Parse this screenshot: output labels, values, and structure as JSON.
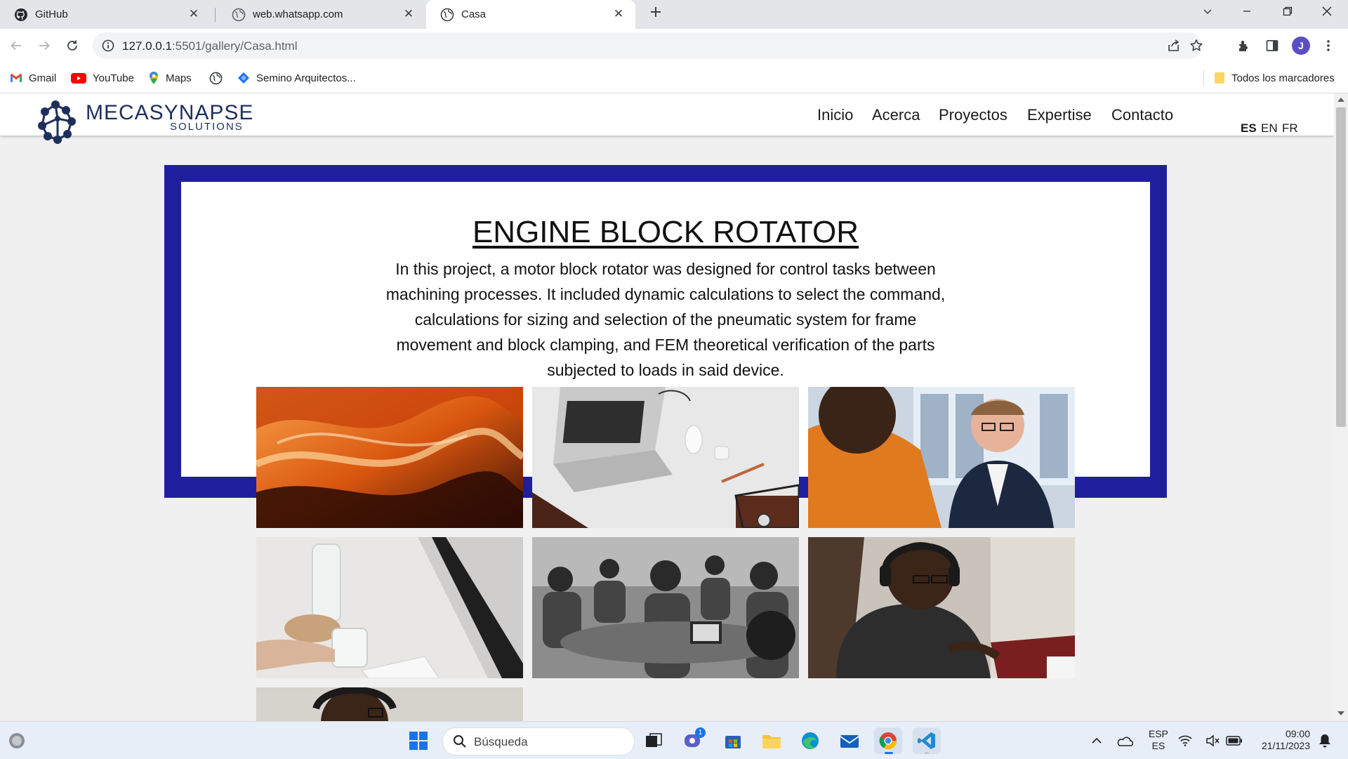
{
  "browser": {
    "tabs": [
      {
        "title": "GitHub",
        "icon": "github-icon"
      },
      {
        "title": "web.whatsapp.com",
        "icon": "globe-icon"
      },
      {
        "title": "Casa",
        "icon": "globe-icon",
        "active": true
      }
    ],
    "url": {
      "host": "127.0.0.1",
      "rest": ":5501/gallery/Casa.html"
    },
    "profile_initial": "J",
    "bookmarks": [
      {
        "label": "Gmail",
        "icon": "gmail-icon"
      },
      {
        "label": "YouTube",
        "icon": "youtube-icon"
      },
      {
        "label": "Maps",
        "icon": "maps-icon"
      },
      {
        "label": "",
        "icon": "globe-icon"
      },
      {
        "label": "Semino Arquitectos...",
        "icon": "diamond-icon"
      }
    ],
    "all_bookmarks": "Todos los marcadores"
  },
  "site": {
    "logo": {
      "name": "MECASYNAPSE",
      "sub": "SOLUTIONS"
    },
    "nav": [
      "Inicio",
      "Acerca",
      "Proyectos",
      "Expertise",
      "Contacto"
    ],
    "languages": [
      "ES",
      "EN",
      "FR"
    ],
    "active_language": "ES",
    "project": {
      "title": "ENGINE BLOCK ROTATOR",
      "description": "In this project, a motor block rotator was designed for control tasks between machining processes. It included dynamic calculations to select the command, calculations for sizing and selection of the pneumatic system for frame movement and block clamping, and FEM theoretical verification of the parts subjected to loads in said device."
    },
    "gallery": [
      {
        "subject": "canyon-photo"
      },
      {
        "subject": "laptop-desk-photo"
      },
      {
        "subject": "businessman-photo"
      },
      {
        "subject": "glass-on-desk-photo"
      },
      {
        "subject": "meeting-photo"
      },
      {
        "subject": "man-headphones-photo"
      },
      {
        "subject": "man-headphones-partial-photo"
      }
    ],
    "colors": {
      "frame": "#1f1f9e",
      "logo": "#1e2f5c"
    }
  },
  "taskbar": {
    "search_placeholder": "Búsqueda",
    "chat_badge": "1",
    "language_top": "ESP",
    "language_bottom": "ES",
    "time": "09:00",
    "date": "21/11/2023"
  }
}
